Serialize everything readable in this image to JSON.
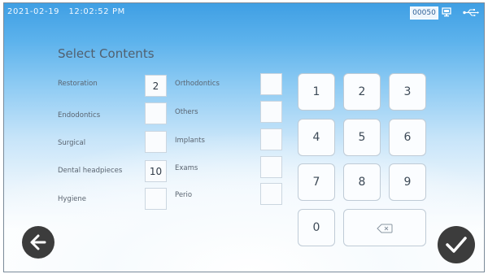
{
  "status_bar": {
    "date": "2021-02-19",
    "time": "12:02:52 PM",
    "counter": "00050"
  },
  "title": "Select Contents",
  "left_items": [
    {
      "label": "Restoration",
      "value": "2"
    },
    {
      "label": "Endodontics",
      "value": ""
    },
    {
      "label": "Surgical",
      "value": ""
    },
    {
      "label": "Dental headpieces",
      "value": "10"
    },
    {
      "label": "Hygiene",
      "value": ""
    }
  ],
  "right_items": [
    {
      "label": "Orthodontics",
      "value": ""
    },
    {
      "label": "Others",
      "value": ""
    },
    {
      "label": "Implants",
      "value": ""
    },
    {
      "label": "Exams",
      "value": ""
    },
    {
      "label": "Perio",
      "value": ""
    }
  ],
  "keypad": {
    "keys": [
      "1",
      "2",
      "3",
      "4",
      "5",
      "6",
      "7",
      "8",
      "9",
      "0"
    ],
    "backspace_icon": "backspace-icon"
  },
  "nav": {
    "back_icon": "arrow-left-icon",
    "confirm_icon": "checkmark-icon"
  },
  "colors": {
    "background_top": "#3f9fe4",
    "button_dark": "#3c3c3c"
  }
}
